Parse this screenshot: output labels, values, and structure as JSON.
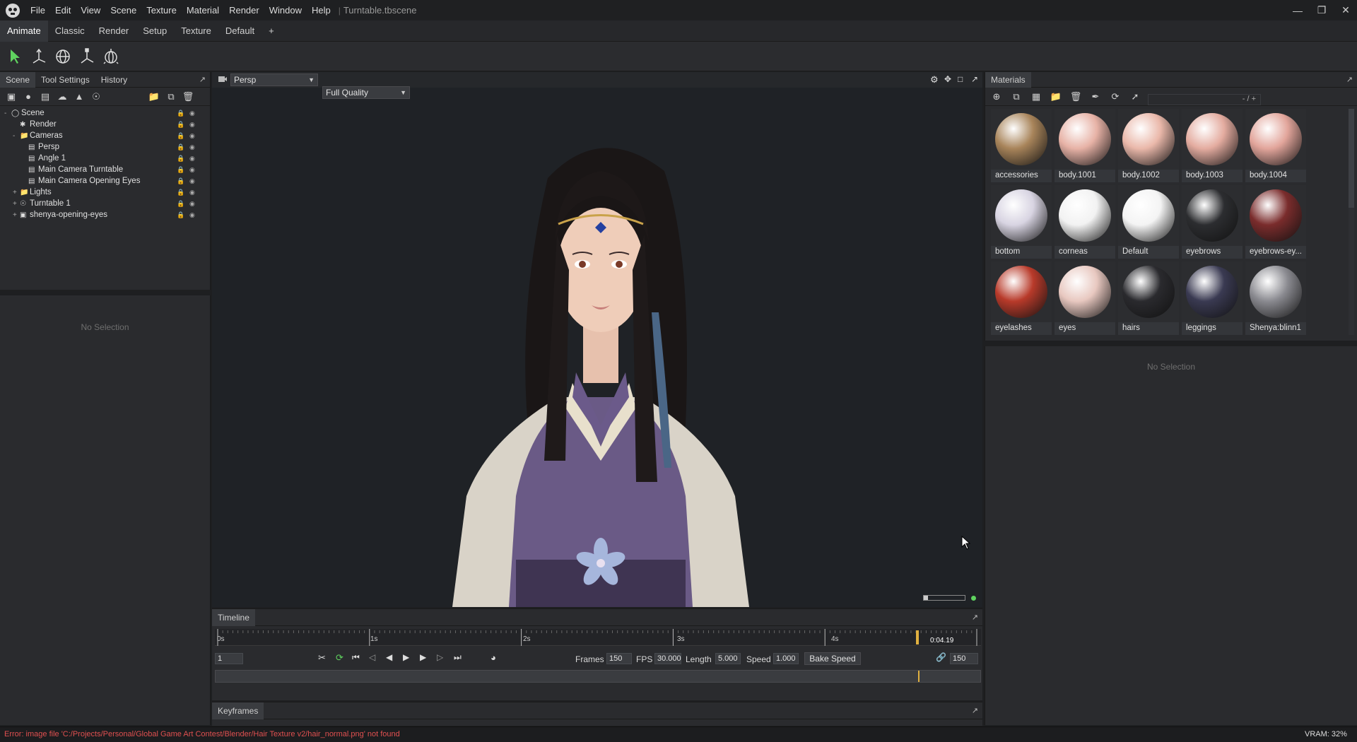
{
  "app": {
    "document": "Turntable.tbscene",
    "menu": [
      "File",
      "Edit",
      "View",
      "Scene",
      "Texture",
      "Material",
      "Render",
      "Window",
      "Help"
    ]
  },
  "workspace_tabs": [
    "Animate",
    "Classic",
    "Render",
    "Setup",
    "Texture",
    "Default",
    "+"
  ],
  "left_panel": {
    "tabs": [
      "Scene",
      "Tool Settings",
      "History"
    ],
    "tree": [
      {
        "label": "Scene",
        "depth": 0,
        "icon": "scene-icon",
        "expand": "-"
      },
      {
        "label": "Render",
        "depth": 1,
        "icon": "render-icon",
        "expand": ""
      },
      {
        "label": "Cameras",
        "depth": 1,
        "icon": "folder-icon",
        "expand": "-"
      },
      {
        "label": "Persp",
        "depth": 2,
        "icon": "camera-icon",
        "expand": ""
      },
      {
        "label": "Angle 1",
        "depth": 2,
        "icon": "camera-icon",
        "expand": "",
        "locked": true
      },
      {
        "label": "Main Camera Turntable",
        "depth": 2,
        "icon": "camera-icon",
        "expand": "",
        "locked": true
      },
      {
        "label": "Main Camera Opening Eyes",
        "depth": 2,
        "icon": "camera-icon",
        "expand": "",
        "locked": true
      },
      {
        "label": "Lights",
        "depth": 1,
        "icon": "folder-icon",
        "expand": "+"
      },
      {
        "label": "Turntable 1",
        "depth": 1,
        "icon": "turntable-icon",
        "expand": "+"
      },
      {
        "label": "shenya-opening-eyes",
        "depth": 1,
        "icon": "object-icon",
        "expand": "+"
      }
    ],
    "properties_empty": "No Selection"
  },
  "viewport": {
    "camera": "Persp",
    "quality": "Full Quality"
  },
  "materials": {
    "title": "Materials",
    "search": "- / +",
    "items": [
      {
        "name": "accessories",
        "color": "#a8845a"
      },
      {
        "name": "body.1001",
        "color": "#e7b2a6"
      },
      {
        "name": "body.1002",
        "color": "#eab8aa"
      },
      {
        "name": "body.1003",
        "color": "#e4aca0"
      },
      {
        "name": "body.1004",
        "color": "#e2a59b"
      },
      {
        "name": "bottom",
        "color": "#d8d4e2"
      },
      {
        "name": "corneas",
        "color": "#f2f2f2"
      },
      {
        "name": "Default",
        "color": "#f4f4f4"
      },
      {
        "name": "eyebrows",
        "color": "#2c2d30"
      },
      {
        "name": "eyebrows-ey...",
        "color": "#7a2c2c"
      },
      {
        "name": "eyelashes",
        "color": "#b83a2a"
      },
      {
        "name": "eyes",
        "color": "#e8c8c0"
      },
      {
        "name": "hairs",
        "color": "#2a2a2e"
      },
      {
        "name": "leggings",
        "color": "#3a3a52"
      },
      {
        "name": "Shenya:blinn1",
        "color": "#8a8a90"
      }
    ],
    "properties_empty": "No Selection"
  },
  "timeline": {
    "title": "Timeline",
    "ticks": [
      "0s",
      "1s",
      "2s",
      "3s",
      "4s"
    ],
    "current_time": "0:04.19",
    "playhead_fraction": 0.92,
    "start_frame": "1",
    "frames_label": "Frames",
    "frames": "150",
    "fps_label": "FPS",
    "fps": "30.000",
    "length_label": "Length",
    "length": "5.000",
    "speed_label": "Speed",
    "speed": "1.000",
    "bake_label": "Bake Speed",
    "end_frame": "150"
  },
  "keyframes": {
    "title": "Keyframes"
  },
  "status": {
    "error": "Error: image file 'C:/Projects/Personal/Global Game Art Contest/Blender/Hair Texture v2/hair_normal.png' not found",
    "vram": "VRAM: 32%"
  },
  "colors": {
    "accent_green": "#5fd35f",
    "error_red": "#e05050",
    "playhead": "#e0b040"
  }
}
